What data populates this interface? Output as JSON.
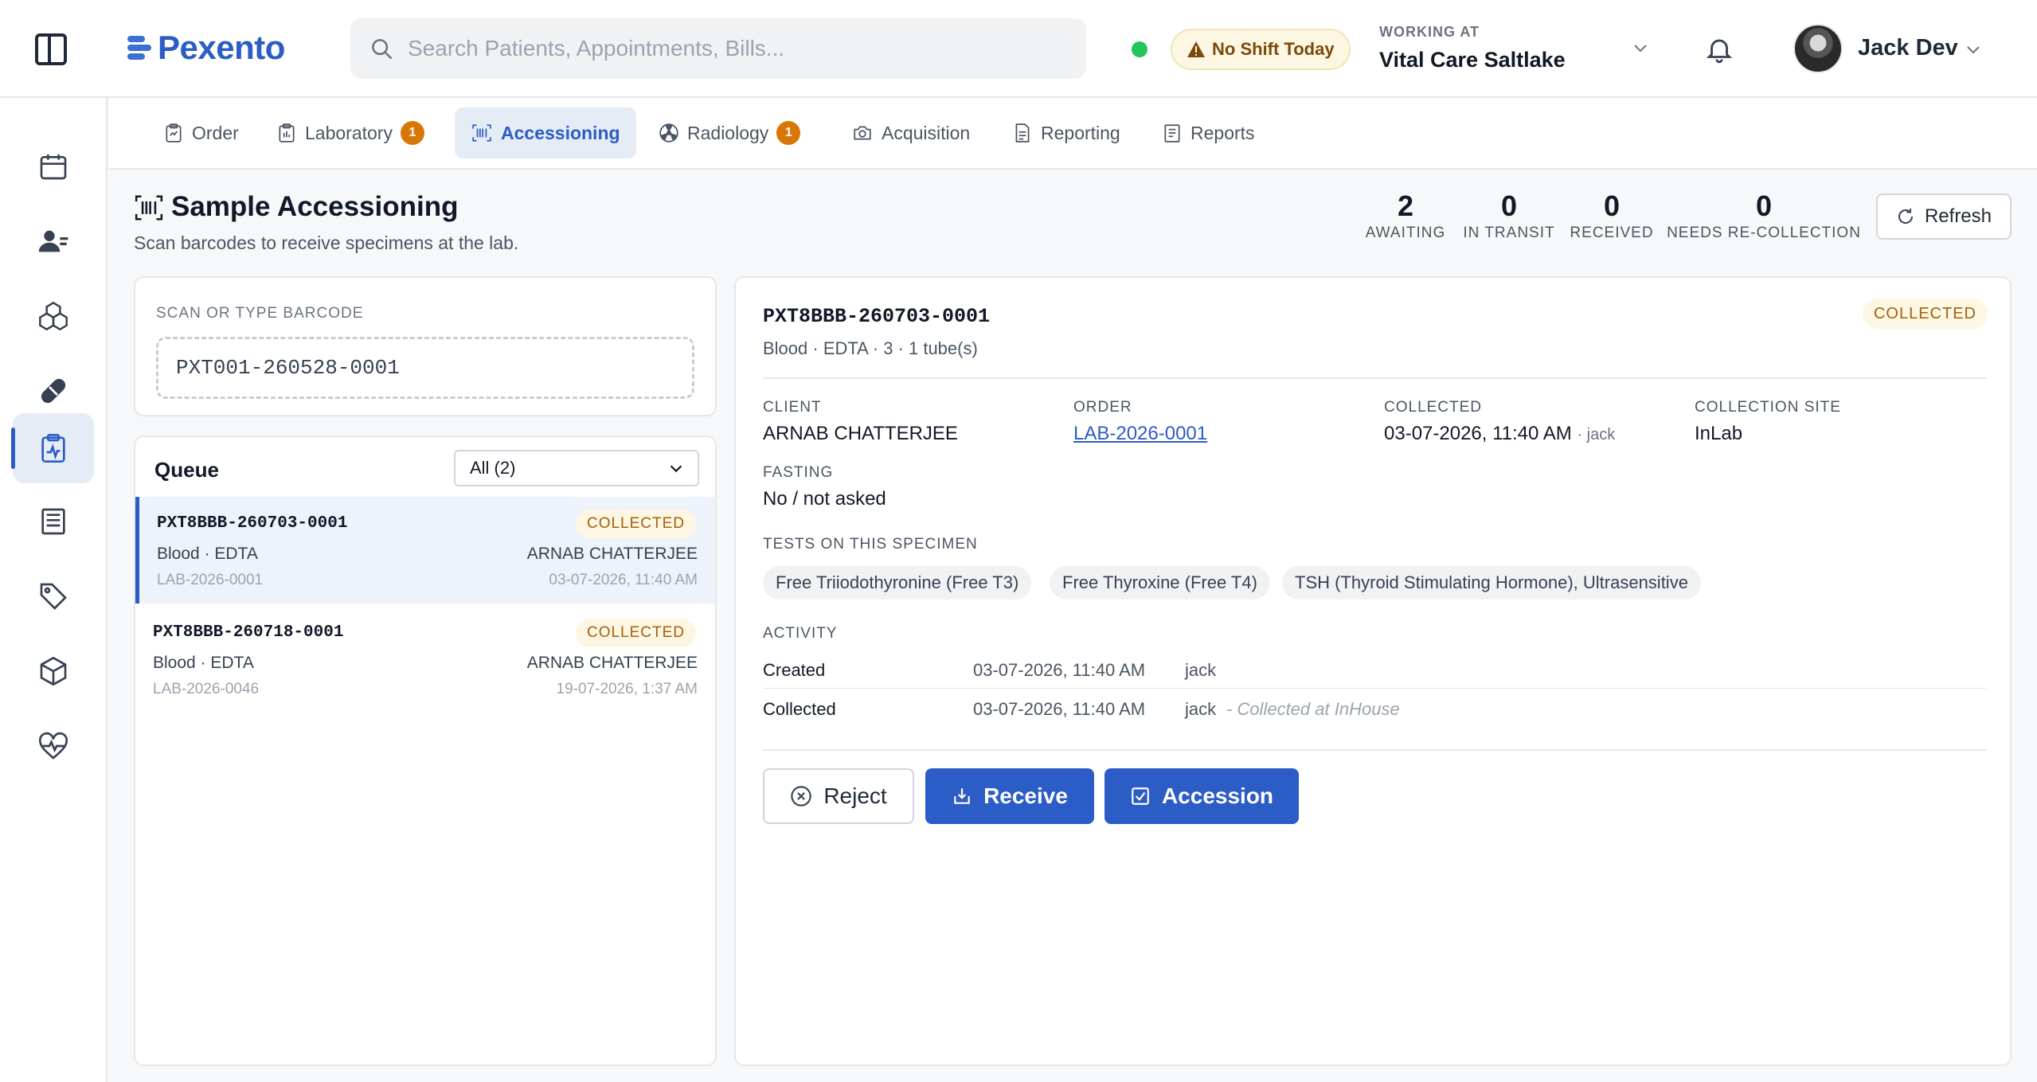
{
  "app": {
    "name": "Pexento"
  },
  "search": {
    "placeholder": "Search Patients, Appointments, Bills..."
  },
  "header": {
    "shift_badge": "No Shift Today",
    "working_label": "WORKING AT",
    "working_value": "Vital Care Saltlake",
    "user_name": "Jack Dev"
  },
  "tabs": [
    {
      "label": "Order",
      "icon": "order-icon"
    },
    {
      "label": "Laboratory",
      "icon": "laboratory-icon",
      "count": "1"
    },
    {
      "label": "Accessioning",
      "icon": "barcode-icon",
      "active": true
    },
    {
      "label": "Radiology",
      "icon": "radiology-icon",
      "count": "1"
    },
    {
      "label": "Acquisition",
      "icon": "camera-icon"
    },
    {
      "label": "Reporting",
      "icon": "reporting-icon"
    },
    {
      "label": "Reports",
      "icon": "reports-icon"
    }
  ],
  "sidebar": {
    "items": [
      {
        "icon": "calendar-icon"
      },
      {
        "icon": "patients-icon"
      },
      {
        "icon": "inventory-icon"
      },
      {
        "icon": "pharmacy-icon"
      },
      {
        "icon": "lab-clipboard-icon",
        "active": true
      },
      {
        "icon": "billing-icon"
      },
      {
        "icon": "tag-icon"
      },
      {
        "icon": "package-icon"
      },
      {
        "icon": "vitals-icon"
      }
    ]
  },
  "page": {
    "title": "Sample Accessioning",
    "subtitle": "Scan barcodes to receive specimens at the lab."
  },
  "stats": [
    {
      "value": "2",
      "label": "AWAITING"
    },
    {
      "value": "0",
      "label": "IN TRANSIT"
    },
    {
      "value": "0",
      "label": "RECEIVED"
    },
    {
      "value": "0",
      "label": "NEEDS RE-COLLECTION"
    }
  ],
  "refresh_label": "Refresh",
  "scan": {
    "label": "SCAN OR TYPE BARCODE",
    "value": "PXT001-260528-0001"
  },
  "queue": {
    "title": "Queue",
    "filter": "All (2)",
    "items": [
      {
        "id": "PXT8BBB-260703-0001",
        "status": "COLLECTED",
        "type": "Blood · EDTA",
        "client": "ARNAB CHATTERJEE",
        "order": "LAB-2026-0001",
        "date": "03-07-2026, 11:40 AM"
      },
      {
        "id": "PXT8BBB-260718-0001",
        "status": "COLLECTED",
        "type": "Blood · EDTA",
        "client": "ARNAB CHATTERJEE",
        "order": "LAB-2026-0046",
        "date": "19-07-2026, 1:37 AM"
      }
    ]
  },
  "detail": {
    "id": "PXT8BBB-260703-0001",
    "status": "COLLECTED",
    "meta": "Blood · EDTA · 3 · 1 tube(s)",
    "client_label": "CLIENT",
    "client": "ARNAB CHATTERJEE",
    "order_label": "ORDER",
    "order": "LAB-2026-0001",
    "collected_label": "COLLECTED",
    "collected": "03-07-2026, 11:40 AM",
    "collected_by": "· jack",
    "site_label": "COLLECTION SITE",
    "site": "InLab",
    "fasting_label": "FASTING",
    "fasting": "No / not asked",
    "tests_label": "TESTS ON THIS SPECIMEN",
    "tests": [
      "Free Triiodothyronine (Free T3)",
      "Free Thyroxine (Free T4)",
      "TSH (Thyroid Stimulating Hormone), Ultrasensitive"
    ],
    "activity_label": "ACTIVITY",
    "activity": [
      {
        "event": "Created",
        "time": "03-07-2026, 11:40 AM",
        "user": "jack",
        "note": ""
      },
      {
        "event": "Collected",
        "time": "03-07-2026, 11:40 AM",
        "user": "jack",
        "note": "- Collected at InHouse"
      }
    ],
    "buttons": {
      "reject": "Reject",
      "receive": "Receive",
      "accession": "Accession"
    }
  },
  "colors": {
    "primary": "#2c5cc5",
    "status_online": "#22c55e",
    "badge_warn": "#d97706",
    "collected_text": "#a16207"
  }
}
